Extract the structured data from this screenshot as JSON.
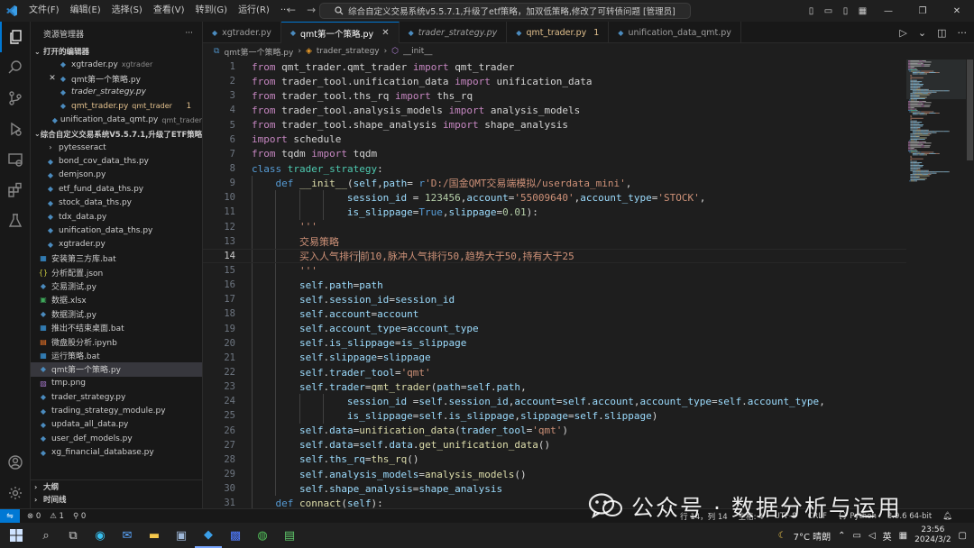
{
  "app": {
    "title": "综合自定义交易系统v5.5.7.1,升级了etf策略，加双低策略,修改了可转债问题 [管理员]",
    "menu": [
      "文件(F)",
      "编辑(E)",
      "选择(S)",
      "查看(V)",
      "转到(G)",
      "运行(R)",
      "···"
    ]
  },
  "sidebar": {
    "title": "资源管理器",
    "more": "···",
    "open_editors_label": "打开的编辑器",
    "open_editors": [
      {
        "name": "xgtrader.py",
        "desc": "xgtrader",
        "italic": false,
        "modified": false,
        "close": false
      },
      {
        "name": "qmt第一个策略.py",
        "desc": "",
        "italic": false,
        "modified": false,
        "close": true
      },
      {
        "name": "trader_strategy.py",
        "desc": "",
        "italic": true,
        "modified": false,
        "close": false
      },
      {
        "name": "qmt_trader.py",
        "desc": "qmt_trader",
        "italic": false,
        "modified": true,
        "badge": "1",
        "close": false
      },
      {
        "name": "unification_data_qmt.py",
        "desc": "qmt_trader",
        "italic": false,
        "modified": false,
        "close": false
      }
    ],
    "workspace_label": "综合自定义交易系统V5.5.7.1,升级了ETF策略，加...",
    "files": [
      {
        "name": "pytesseract",
        "type": "folder",
        "indent": 1
      },
      {
        "name": "bond_cov_data_ths.py",
        "type": "py",
        "indent": 1
      },
      {
        "name": "demjson.py",
        "type": "py",
        "indent": 1
      },
      {
        "name": "etf_fund_data_ths.py",
        "type": "py",
        "indent": 1
      },
      {
        "name": "stock_data_ths.py",
        "type": "py",
        "indent": 1
      },
      {
        "name": "tdx_data.py",
        "type": "py",
        "indent": 1
      },
      {
        "name": "unification_data_ths.py",
        "type": "py",
        "indent": 1
      },
      {
        "name": "xgtrader.py",
        "type": "py",
        "indent": 1
      },
      {
        "name": "安装第三方库.bat",
        "type": "bat",
        "indent": 0
      },
      {
        "name": "分析配置.json",
        "type": "json",
        "indent": 0
      },
      {
        "name": "交易测试.py",
        "type": "py",
        "indent": 0
      },
      {
        "name": "数据.xlsx",
        "type": "xlsx",
        "indent": 0
      },
      {
        "name": "数据测试.py",
        "type": "py",
        "indent": 0
      },
      {
        "name": "推出不结束桌面.bat",
        "type": "bat",
        "indent": 0
      },
      {
        "name": "微盘股分析.ipynb",
        "type": "ipynb",
        "indent": 0
      },
      {
        "name": "运行策略.bat",
        "type": "bat",
        "indent": 0
      },
      {
        "name": "qmt第一个策略.py",
        "type": "py",
        "indent": 0,
        "selected": true
      },
      {
        "name": "tmp.png",
        "type": "png",
        "indent": 0
      },
      {
        "name": "trader_strategy.py",
        "type": "py",
        "indent": 0
      },
      {
        "name": "trading_strategy_module.py",
        "type": "py",
        "indent": 0
      },
      {
        "name": "updata_all_data.py",
        "type": "py",
        "indent": 0
      },
      {
        "name": "user_def_models.py",
        "type": "py",
        "indent": 0
      },
      {
        "name": "xg_financial_database.py",
        "type": "py",
        "indent": 0
      }
    ],
    "outline_label": "大纲",
    "timeline_label": "时间线"
  },
  "tabs": [
    {
      "label": "xgtrader.py",
      "active": false,
      "italic": false,
      "modified": false,
      "num": ""
    },
    {
      "label": "qmt第一个策略.py",
      "active": true,
      "italic": false,
      "modified": false,
      "num": ""
    },
    {
      "label": "trader_strategy.py",
      "active": false,
      "italic": true,
      "modified": false,
      "num": ""
    },
    {
      "label": "qmt_trader.py",
      "active": false,
      "italic": false,
      "modified": true,
      "num": "1"
    },
    {
      "label": "unification_data_qmt.py",
      "active": false,
      "italic": false,
      "modified": false,
      "num": ""
    }
  ],
  "breadcrumb": {
    "file": "qmt第一个策略.py",
    "cls": "trader_strategy",
    "method": "__init__"
  },
  "editor": {
    "current_line": 14,
    "lines": [
      {
        "n": 1,
        "ind": 0,
        "t": [
          [
            "kw",
            "from "
          ],
          [
            "tx",
            "qmt_trader.qmt_trader "
          ],
          [
            "kw",
            "import "
          ],
          [
            "tx",
            "qmt_trader"
          ]
        ]
      },
      {
        "n": 2,
        "ind": 0,
        "t": [
          [
            "kw",
            "from "
          ],
          [
            "tx",
            "trader_tool.unification_data "
          ],
          [
            "kw",
            "import "
          ],
          [
            "tx",
            "unification_data"
          ]
        ]
      },
      {
        "n": 3,
        "ind": 0,
        "t": [
          [
            "kw",
            "from "
          ],
          [
            "tx",
            "trader_tool.ths_rq "
          ],
          [
            "kw",
            "import "
          ],
          [
            "tx",
            "ths_rq"
          ]
        ]
      },
      {
        "n": 4,
        "ind": 0,
        "t": [
          [
            "kw",
            "from "
          ],
          [
            "tx",
            "trader_tool.analysis_models "
          ],
          [
            "kw",
            "import "
          ],
          [
            "tx",
            "analysis_models"
          ]
        ]
      },
      {
        "n": 5,
        "ind": 0,
        "t": [
          [
            "kw",
            "from "
          ],
          [
            "tx",
            "trader_tool.shape_analysis "
          ],
          [
            "kw",
            "import "
          ],
          [
            "tx",
            "shape_analysis"
          ]
        ]
      },
      {
        "n": 6,
        "ind": 0,
        "t": [
          [
            "kw",
            "import "
          ],
          [
            "tx",
            "schedule"
          ]
        ]
      },
      {
        "n": 7,
        "ind": 0,
        "t": [
          [
            "kw",
            "from "
          ],
          [
            "tx",
            "tqdm "
          ],
          [
            "kw",
            "import "
          ],
          [
            "tx",
            "tqdm"
          ]
        ]
      },
      {
        "n": 8,
        "ind": 0,
        "t": [
          [
            "df",
            "class "
          ],
          [
            "cl",
            "trader_strategy"
          ],
          [
            "tx",
            ":"
          ]
        ]
      },
      {
        "n": 9,
        "ind": 1,
        "t": [
          [
            "df",
            "def "
          ],
          [
            "fn",
            "__init__"
          ],
          [
            "tx",
            "("
          ],
          [
            "vr",
            "self"
          ],
          [
            "tx",
            ","
          ],
          [
            "vr",
            "path"
          ],
          [
            "tx",
            "= "
          ],
          [
            "df",
            "r"
          ],
          [
            "st",
            "'D:/国金QMT交易端模拟/userdata_mini'"
          ],
          [
            "tx",
            ","
          ]
        ]
      },
      {
        "n": 10,
        "ind": 4,
        "t": [
          [
            "vr",
            "session_id "
          ],
          [
            "tx",
            "= "
          ],
          [
            "nm",
            "123456"
          ],
          [
            "tx",
            ","
          ],
          [
            "vr",
            "account"
          ],
          [
            "tx",
            "="
          ],
          [
            "st",
            "'55009640'"
          ],
          [
            "tx",
            ","
          ],
          [
            "vr",
            "account_type"
          ],
          [
            "tx",
            "="
          ],
          [
            "st",
            "'STOCK'"
          ],
          [
            "tx",
            ","
          ]
        ]
      },
      {
        "n": 11,
        "ind": 4,
        "t": [
          [
            "vr",
            "is_slippage"
          ],
          [
            "tx",
            "="
          ],
          [
            "df",
            "True"
          ],
          [
            "tx",
            ","
          ],
          [
            "vr",
            "slippage"
          ],
          [
            "tx",
            "="
          ],
          [
            "nm",
            "0.01"
          ],
          [
            "tx",
            "):"
          ]
        ]
      },
      {
        "n": 12,
        "ind": 2,
        "t": [
          [
            "st",
            "'''"
          ]
        ]
      },
      {
        "n": 13,
        "ind": 2,
        "t": [
          [
            "st",
            "交易策略"
          ]
        ]
      },
      {
        "n": 14,
        "ind": 2,
        "t": [
          [
            "st",
            "买入人气排行前10,脉冲人气排行50,趋势大于50,持有大于25"
          ]
        ],
        "caret": 6
      },
      {
        "n": 15,
        "ind": 2,
        "t": [
          [
            "st",
            "'''"
          ]
        ]
      },
      {
        "n": 16,
        "ind": 2,
        "t": [
          [
            "vr",
            "self"
          ],
          [
            "tx",
            "."
          ],
          [
            "vr",
            "path"
          ],
          [
            "tx",
            "="
          ],
          [
            "vr",
            "path"
          ]
        ]
      },
      {
        "n": 17,
        "ind": 2,
        "t": [
          [
            "vr",
            "self"
          ],
          [
            "tx",
            "."
          ],
          [
            "vr",
            "session_id"
          ],
          [
            "tx",
            "="
          ],
          [
            "vr",
            "session_id"
          ]
        ]
      },
      {
        "n": 18,
        "ind": 2,
        "t": [
          [
            "vr",
            "self"
          ],
          [
            "tx",
            "."
          ],
          [
            "vr",
            "account"
          ],
          [
            "tx",
            "="
          ],
          [
            "vr",
            "account"
          ]
        ]
      },
      {
        "n": 19,
        "ind": 2,
        "t": [
          [
            "vr",
            "self"
          ],
          [
            "tx",
            "."
          ],
          [
            "vr",
            "account_type"
          ],
          [
            "tx",
            "="
          ],
          [
            "vr",
            "account_type"
          ]
        ]
      },
      {
        "n": 20,
        "ind": 2,
        "t": [
          [
            "vr",
            "self"
          ],
          [
            "tx",
            "."
          ],
          [
            "vr",
            "is_slippage"
          ],
          [
            "tx",
            "="
          ],
          [
            "vr",
            "is_slippage"
          ]
        ]
      },
      {
        "n": 21,
        "ind": 2,
        "t": [
          [
            "vr",
            "self"
          ],
          [
            "tx",
            "."
          ],
          [
            "vr",
            "slippage"
          ],
          [
            "tx",
            "="
          ],
          [
            "vr",
            "slippage"
          ]
        ]
      },
      {
        "n": 22,
        "ind": 2,
        "t": [
          [
            "vr",
            "self"
          ],
          [
            "tx",
            "."
          ],
          [
            "vr",
            "trader_tool"
          ],
          [
            "tx",
            "="
          ],
          [
            "st",
            "'qmt'"
          ]
        ]
      },
      {
        "n": 23,
        "ind": 2,
        "t": [
          [
            "vr",
            "self"
          ],
          [
            "tx",
            "."
          ],
          [
            "vr",
            "trader"
          ],
          [
            "tx",
            "="
          ],
          [
            "fn",
            "qmt_trader"
          ],
          [
            "tx",
            "("
          ],
          [
            "vr",
            "path"
          ],
          [
            "tx",
            "="
          ],
          [
            "vr",
            "self"
          ],
          [
            "tx",
            "."
          ],
          [
            "vr",
            "path"
          ],
          [
            "tx",
            ","
          ]
        ]
      },
      {
        "n": 24,
        "ind": 4,
        "t": [
          [
            "vr",
            "session_id "
          ],
          [
            "tx",
            "="
          ],
          [
            "vr",
            "self"
          ],
          [
            "tx",
            "."
          ],
          [
            "vr",
            "session_id"
          ],
          [
            "tx",
            ","
          ],
          [
            "vr",
            "account"
          ],
          [
            "tx",
            "="
          ],
          [
            "vr",
            "self"
          ],
          [
            "tx",
            "."
          ],
          [
            "vr",
            "account"
          ],
          [
            "tx",
            ","
          ],
          [
            "vr",
            "account_type"
          ],
          [
            "tx",
            "="
          ],
          [
            "vr",
            "self"
          ],
          [
            "tx",
            "."
          ],
          [
            "vr",
            "account_type"
          ],
          [
            "tx",
            ","
          ]
        ]
      },
      {
        "n": 25,
        "ind": 4,
        "t": [
          [
            "vr",
            "is_slippage"
          ],
          [
            "tx",
            "="
          ],
          [
            "vr",
            "self"
          ],
          [
            "tx",
            "."
          ],
          [
            "vr",
            "is_slippage"
          ],
          [
            "tx",
            ","
          ],
          [
            "vr",
            "slippage"
          ],
          [
            "tx",
            "="
          ],
          [
            "vr",
            "self"
          ],
          [
            "tx",
            "."
          ],
          [
            "vr",
            "slippage"
          ],
          [
            "tx",
            ")"
          ]
        ]
      },
      {
        "n": 26,
        "ind": 2,
        "t": [
          [
            "vr",
            "self"
          ],
          [
            "tx",
            "."
          ],
          [
            "vr",
            "data"
          ],
          [
            "tx",
            "="
          ],
          [
            "fn",
            "unification_data"
          ],
          [
            "tx",
            "("
          ],
          [
            "vr",
            "trader_tool"
          ],
          [
            "tx",
            "="
          ],
          [
            "st",
            "'qmt'"
          ],
          [
            "tx",
            ")"
          ]
        ]
      },
      {
        "n": 27,
        "ind": 2,
        "t": [
          [
            "vr",
            "self"
          ],
          [
            "tx",
            "."
          ],
          [
            "vr",
            "data"
          ],
          [
            "tx",
            "="
          ],
          [
            "vr",
            "self"
          ],
          [
            "tx",
            "."
          ],
          [
            "vr",
            "data"
          ],
          [
            "tx",
            "."
          ],
          [
            "fn",
            "get_unification_data"
          ],
          [
            "tx",
            "()"
          ]
        ]
      },
      {
        "n": 28,
        "ind": 2,
        "t": [
          [
            "vr",
            "self"
          ],
          [
            "tx",
            "."
          ],
          [
            "vr",
            "ths_rq"
          ],
          [
            "tx",
            "="
          ],
          [
            "fn",
            "ths_rq"
          ],
          [
            "tx",
            "()"
          ]
        ]
      },
      {
        "n": 29,
        "ind": 2,
        "t": [
          [
            "vr",
            "self"
          ],
          [
            "tx",
            "."
          ],
          [
            "vr",
            "analysis_models"
          ],
          [
            "tx",
            "="
          ],
          [
            "fn",
            "analysis_models"
          ],
          [
            "tx",
            "()"
          ]
        ]
      },
      {
        "n": 30,
        "ind": 2,
        "t": [
          [
            "vr",
            "self"
          ],
          [
            "tx",
            "."
          ],
          [
            "vr",
            "shape_analysis"
          ],
          [
            "tx",
            "="
          ],
          [
            "vr",
            "shape_analysis"
          ]
        ]
      },
      {
        "n": 31,
        "ind": 1,
        "t": [
          [
            "df",
            "def "
          ],
          [
            "fn",
            "connact"
          ],
          [
            "tx",
            "("
          ],
          [
            "vr",
            "self"
          ],
          [
            "tx",
            "):"
          ]
        ]
      }
    ]
  },
  "status": {
    "errors": "⊗ 0",
    "warnings": "⚠ 1",
    "ports": "⚲ 0",
    "position": "行 14，列 14",
    "spaces": "空格: 4",
    "encoding": "UTF-8",
    "eol": "CRLF",
    "language": "{} Python",
    "interpreter": "3.9.6 64-bit"
  },
  "taskbar": {
    "weather": "7°C 晴朗",
    "ime": "英",
    "time": "23:56",
    "date": "2024/3/2"
  },
  "watermark": {
    "text": "公众号 · 数据分析与运用"
  },
  "colors": {
    "accent": "#0078d4",
    "modified": "#e2c08d"
  }
}
